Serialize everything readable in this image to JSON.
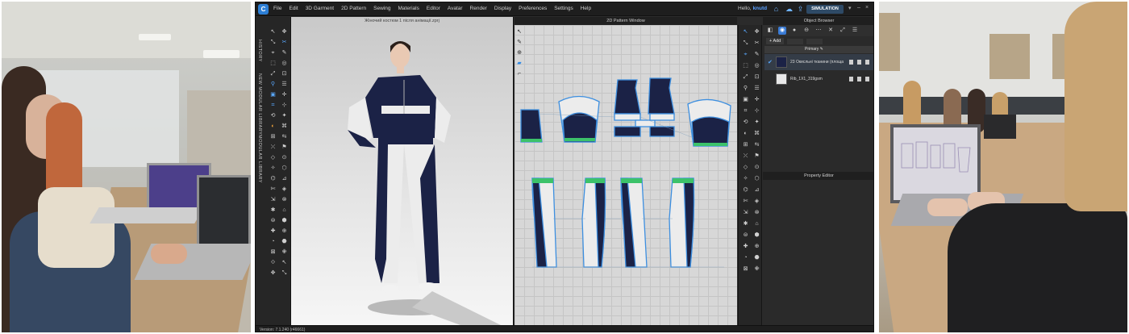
{
  "app": {
    "menu": [
      "File",
      "Edit",
      "3D Garment",
      "2D Pattern",
      "Sewing",
      "Materials",
      "Editor",
      "Avatar",
      "Render",
      "Display",
      "Preferences",
      "Settings",
      "Help"
    ],
    "user_greeting": "Hello,",
    "user_name": "knutd",
    "simulation_label": "SIMULATION",
    "left_tabs": [
      "HISTORY",
      "NEW MODULAR LIBRARY",
      "MODULAR LIBRARY"
    ],
    "view3d_title": "Жіночий костюм 1 після анімації.zprj",
    "view2d_title": "2D Pattern Window",
    "object_browser_title": "Object Browser",
    "add_label": "Add",
    "primary_label": "Primary",
    "fabrics": [
      {
        "name": "23 Окисльні тканини (площа",
        "color": "#1b2246",
        "selected": true
      },
      {
        "name": "Rib_1X1_319gsm",
        "color": "#e8e8e8",
        "selected": false
      }
    ],
    "property_editor_title": "Property Editor",
    "version_text": "Version: 7.1.240 (r46661)",
    "garment_colors": {
      "navy": "#1b2246",
      "white": "#ececec",
      "green": "#3cc26a",
      "outline": "#3d8fe0"
    }
  }
}
